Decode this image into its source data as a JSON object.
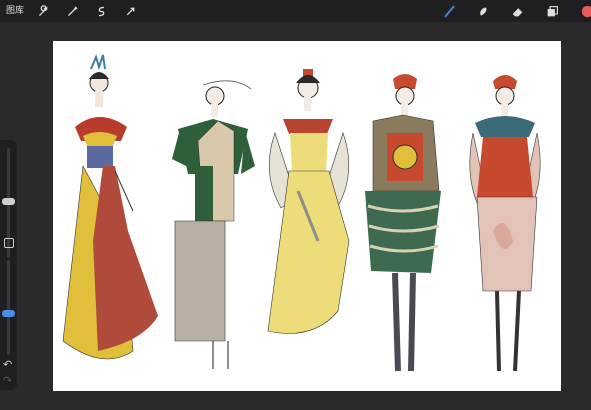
{
  "topbar": {
    "gallery_label": "图库",
    "actions": [
      {
        "name": "wrench-icon"
      },
      {
        "name": "adjustments-icon"
      },
      {
        "name": "selection-icon"
      },
      {
        "name": "transform-arrow-icon"
      }
    ],
    "tools": [
      {
        "name": "brush-icon",
        "active": true
      },
      {
        "name": "smudge-icon",
        "active": false
      },
      {
        "name": "eraser-icon",
        "active": false
      },
      {
        "name": "layers-icon",
        "active": false
      }
    ],
    "color_swatch": "#e8595b"
  },
  "sidebar": {
    "size_slider_level": 0.55,
    "opacity_slider_level": 0.3,
    "modify_button": "square-icon",
    "undo": "undo-icon",
    "redo": "redo-icon"
  },
  "canvas": {
    "figures": [
      {
        "name": "figure-1-yellow-red-gown",
        "colors": [
          "#e0bf3a",
          "#b04a3b",
          "#6b2f3b"
        ]
      },
      {
        "name": "figure-2-green-jacket",
        "colors": [
          "#2f5e3a",
          "#d9c8a9",
          "#b8b0a3"
        ]
      },
      {
        "name": "figure-3-yellow-draped-dress",
        "colors": [
          "#eddc7a",
          "#8a8f8a",
          "#b8452f"
        ]
      },
      {
        "name": "figure-4-striped-skirt",
        "colors": [
          "#3e6b4f",
          "#c74a2e",
          "#6b4a3a"
        ]
      },
      {
        "name": "figure-5-pink-dress",
        "colors": [
          "#e2c3b8",
          "#3b6b77",
          "#c74a2e"
        ]
      }
    ]
  }
}
